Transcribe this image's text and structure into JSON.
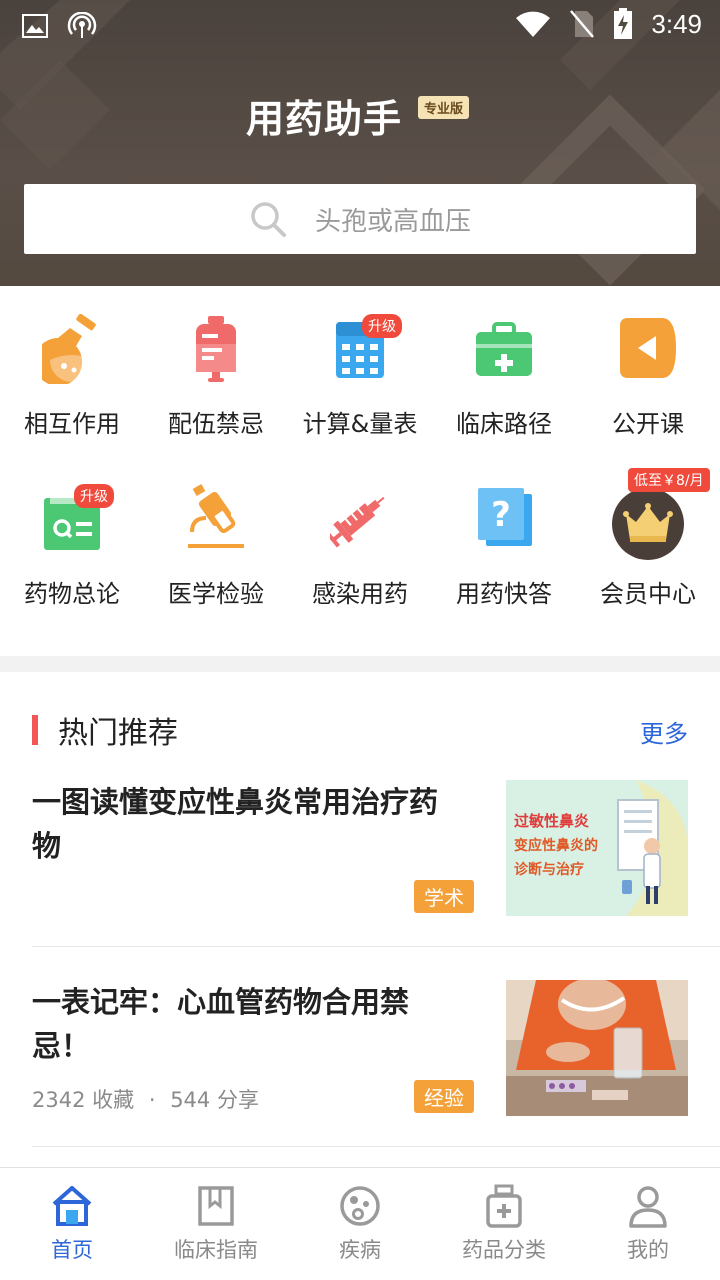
{
  "status_bar": {
    "time": "3:49"
  },
  "header": {
    "app_title": "用药助手",
    "edition_badge": "专业版",
    "search_placeholder": "头孢或高血压"
  },
  "quick_grid": [
    {
      "label": "相互作用",
      "icon": "flask-icon",
      "color": "#f5a13a"
    },
    {
      "label": "配伍禁忌",
      "icon": "iv-bag-icon",
      "color": "#f06a6a"
    },
    {
      "label": "计算&量表",
      "icon": "calculator-icon",
      "color": "#3aa7ee",
      "tag": "升级"
    },
    {
      "label": "临床路径",
      "icon": "medical-kit-icon",
      "color": "#4cc874"
    },
    {
      "label": "公开课",
      "icon": "play-icon",
      "color": "#f5a13a"
    },
    {
      "label": "药物总论",
      "icon": "drug-book-icon",
      "color": "#4cc874",
      "tag": "升级"
    },
    {
      "label": "医学检验",
      "icon": "microscope-icon",
      "color": "#f5a13a"
    },
    {
      "label": "感染用药",
      "icon": "syringe-icon",
      "color": "#f06a6a"
    },
    {
      "label": "用药快答",
      "icon": "question-icon",
      "color": "#3aa7ee"
    },
    {
      "label": "会员中心",
      "icon": "crown-icon",
      "color": "#4a3f38",
      "tag": "低至￥8/月"
    }
  ],
  "hot": {
    "title": "热门推荐",
    "more": "更多",
    "articles": [
      {
        "title": "一图读懂变应性鼻炎常用治疗药物",
        "badge": "学术",
        "thumb_lines": [
          "过敏性鼻炎",
          "变应性鼻炎的",
          "诊断与治疗"
        ]
      },
      {
        "title": "一表记牢：心血管药物合用禁忌！",
        "badge": "经验",
        "favorites": "2342 收藏",
        "dot": "·",
        "shares": "544 分享"
      }
    ]
  },
  "bottom_nav": [
    {
      "label": "首页",
      "icon": "home-icon",
      "active": true
    },
    {
      "label": "临床指南",
      "icon": "bookmark-book-icon",
      "active": false
    },
    {
      "label": "疾病",
      "icon": "virus-icon",
      "active": false
    },
    {
      "label": "药品分类",
      "icon": "medicine-bottle-icon",
      "active": false
    },
    {
      "label": "我的",
      "icon": "user-icon",
      "active": false
    }
  ]
}
